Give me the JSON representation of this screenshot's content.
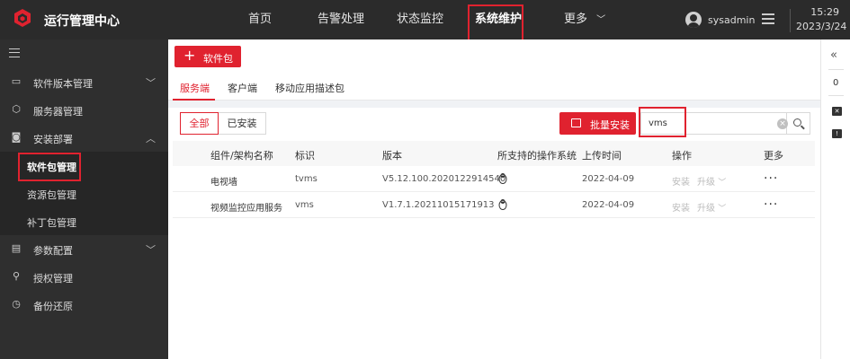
{
  "header": {
    "app_title": "运行管理中心",
    "nav": [
      "首页",
      "告警处理",
      "状态监控",
      "系统维护",
      "更多"
    ],
    "active_nav": "系统维护",
    "username": "sysadmin",
    "time": "15:29",
    "date": "2023/3/24"
  },
  "sidebar": {
    "items": [
      {
        "label": "软件版本管理",
        "icon": "monitor-icon"
      },
      {
        "label": "服务器管理",
        "icon": "cube-icon"
      },
      {
        "label": "安装部署",
        "icon": "deploy-icon"
      },
      {
        "label": "软件包管理",
        "icon": ""
      },
      {
        "label": "资源包管理",
        "icon": ""
      },
      {
        "label": "补丁包管理",
        "icon": ""
      },
      {
        "label": "参数配置",
        "icon": "config-icon"
      },
      {
        "label": "授权管理",
        "icon": "key-icon"
      },
      {
        "label": "备份还原",
        "icon": "clock-icon"
      }
    ],
    "active": "软件包管理"
  },
  "main": {
    "add_button": "软件包",
    "tabs": [
      "服务端",
      "客户端",
      "移动应用描述包"
    ],
    "active_tab": "服务端",
    "filters": [
      "全部",
      "已安装"
    ],
    "active_filter": "全部",
    "batch_install": "批量安装",
    "search_value": "vms",
    "columns": [
      "组件/架构名称",
      "标识",
      "版本",
      "所支持的操作系统",
      "上传时间",
      "操作",
      "更多"
    ],
    "rows": [
      {
        "name": "电视墙",
        "id": "tvms",
        "version": "V5.12.100.2020122914540",
        "os": "linux-icon",
        "upload": "2022-04-09",
        "install": "安装",
        "upgrade": "升级",
        "more": "···"
      },
      {
        "name": "视频监控应用服务",
        "id": "vms",
        "version": "V1.7.1.20211015171913",
        "os": "linux-icon",
        "upload": "2022-04-09",
        "install": "安装",
        "upgrade": "升级",
        "more": "···"
      }
    ]
  },
  "rightbar": {
    "count": "0"
  },
  "colors": {
    "accent": "#e0222f",
    "topbar": "#2b2b2b",
    "sidebar": "#2f2f2f"
  }
}
